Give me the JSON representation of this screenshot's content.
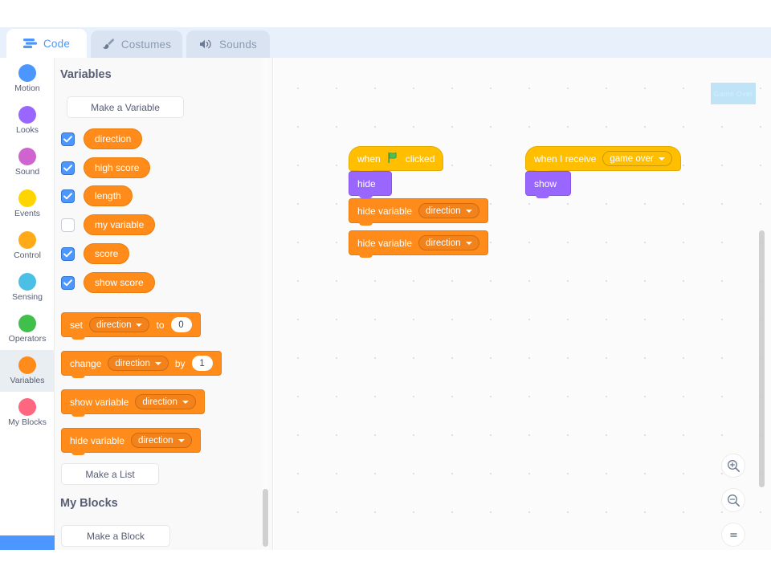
{
  "tabs": [
    {
      "label": "Code",
      "icon": "code-blocks-icon",
      "selected": true
    },
    {
      "label": "Costumes",
      "icon": "paintbrush-icon",
      "selected": false
    },
    {
      "label": "Sounds",
      "icon": "speaker-icon",
      "selected": false
    }
  ],
  "categories": [
    {
      "label": "Motion",
      "color": "#4c97ff",
      "selected": false
    },
    {
      "label": "Looks",
      "color": "#9966ff",
      "selected": false
    },
    {
      "label": "Sound",
      "color": "#cf63cf",
      "selected": false
    },
    {
      "label": "Events",
      "color": "#ffd500",
      "selected": false
    },
    {
      "label": "Control",
      "color": "#ffab19",
      "selected": false
    },
    {
      "label": "Sensing",
      "color": "#4cbfe6",
      "selected": false
    },
    {
      "label": "Operators",
      "color": "#40bf4a",
      "selected": false
    },
    {
      "label": "Variables",
      "color": "#ff8c1a",
      "selected": true
    },
    {
      "label": "My Blocks",
      "color": "#ff6680",
      "selected": false
    }
  ],
  "palette": {
    "variables_header": "Variables",
    "make_variable_label": "Make a Variable",
    "make_list_label": "Make a List",
    "myblocks_header": "My Blocks",
    "make_block_label": "Make a Block",
    "variables": [
      {
        "name": "direction",
        "checked": true
      },
      {
        "name": "high score",
        "checked": true
      },
      {
        "name": "length",
        "checked": true
      },
      {
        "name": "my variable",
        "checked": false
      },
      {
        "name": "score",
        "checked": true
      },
      {
        "name": "show score",
        "checked": true
      }
    ],
    "blocks": [
      {
        "id": "set-var",
        "text_before": "set",
        "dropdown": "direction",
        "text_mid": "to",
        "value": "0"
      },
      {
        "id": "change-var",
        "text_before": "change",
        "dropdown": "direction",
        "text_mid": "by",
        "value": "1"
      },
      {
        "id": "show-var",
        "text_before": "show variable",
        "dropdown": "direction"
      },
      {
        "id": "hide-var",
        "text_before": "hide variable",
        "dropdown": "direction"
      }
    ]
  },
  "workspace": {
    "sprite_label": "Game Over",
    "scripts": [
      {
        "id": "green-flag-script",
        "blocks": [
          {
            "type": "hat",
            "category": "events",
            "text_before": "when",
            "icon": "green-flag-icon",
            "text_after": "clicked"
          },
          {
            "type": "stack",
            "category": "looks",
            "text_before": "hide"
          },
          {
            "type": "stack",
            "category": "variables",
            "text_before": "hide variable",
            "dropdown": "direction"
          },
          {
            "type": "stack",
            "category": "variables",
            "text_before": "hide variable",
            "dropdown": "direction"
          }
        ]
      },
      {
        "id": "receive-script",
        "blocks": [
          {
            "type": "hat",
            "category": "events",
            "text_before": "when I receive",
            "dropdown": "game over"
          },
          {
            "type": "stack",
            "category": "looks",
            "text_before": "show"
          }
        ]
      }
    ],
    "zoom_controls": [
      {
        "label": "zoom-in",
        "glyph": "+"
      },
      {
        "label": "zoom-out",
        "glyph": "−"
      },
      {
        "label": "zoom-reset",
        "glyph": "="
      }
    ]
  }
}
